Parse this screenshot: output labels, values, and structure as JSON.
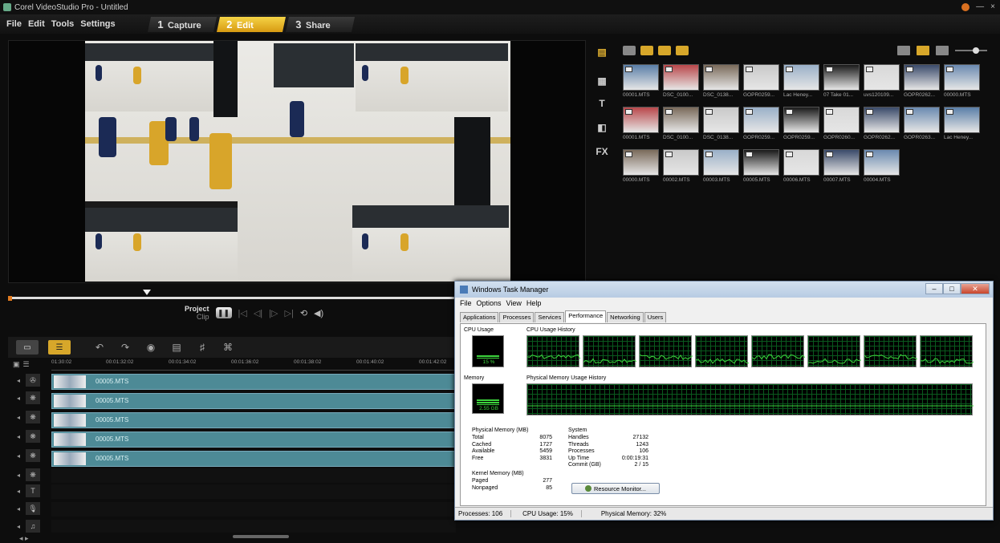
{
  "app": {
    "title": "Corel VideoStudio Pro - Untitled",
    "menu": [
      "File",
      "Edit",
      "Tools",
      "Settings"
    ],
    "steps": [
      {
        "num": "1",
        "label": "Capture",
        "active": false
      },
      {
        "num": "2",
        "label": "Edit",
        "active": true
      },
      {
        "num": "3",
        "label": "Share",
        "active": false
      }
    ],
    "window_controls": {
      "minimize": "—",
      "close": "×"
    }
  },
  "player": {
    "project_label": "Project",
    "clip_label": "Clip"
  },
  "library": {
    "side_tabs": [
      "media-icon",
      "instant-project-icon",
      "title-icon",
      "transition-icon",
      "FX"
    ],
    "thumbnails": [
      [
        "00001.MTS",
        "DSC_0100...",
        "DSC_0138...",
        "GOPR0259...",
        "Lac Heney...",
        "07 Take 01...",
        "uvs120109...",
        "GOPR0262...",
        "00000.MTS"
      ],
      [
        "00001.MTS",
        "DSC_0100...",
        "DSC_0138...",
        "GOPR0259...",
        "GOPR0259...",
        "GOPR0260...",
        "GOPR0262...",
        "GOPR0263...",
        "Lac Heney..."
      ],
      [
        "00000.MTS",
        "00002.MTS",
        "00003.MTS",
        "00005.MTS",
        "00006.MTS",
        "00007.MTS",
        "00004.MTS"
      ]
    ]
  },
  "timeline": {
    "ruler": [
      "01:30:02",
      "00:01:32:02",
      "00:01:34:02",
      "00:01:36:02",
      "00:01:38:02",
      "00:01:40:02",
      "00:01:42:02"
    ],
    "clips": [
      "00005.MTS",
      "00005.MTS",
      "00005.MTS",
      "00005.MTS",
      "00005.MTS"
    ],
    "track_icons": [
      "video-track",
      "overlay-track",
      "overlay-track",
      "overlay-track",
      "overlay-track",
      "overlay-track",
      "title-track",
      "voice-track",
      "music-track"
    ]
  },
  "task_manager": {
    "title": "Windows Task Manager",
    "menu": [
      "File",
      "Options",
      "View",
      "Help"
    ],
    "tabs": [
      "Applications",
      "Processes",
      "Services",
      "Performance",
      "Networking",
      "Users"
    ],
    "active_tab": "Performance",
    "cpu_usage_label": "CPU Usage",
    "cpu_usage_value": "15 %",
    "cpu_usage_pct": 15,
    "cpu_history_label": "CPU Usage History",
    "memory_label": "Memory",
    "memory_value": "2.55 GB",
    "memory_pct": 32,
    "memory_history_label": "Physical Memory Usage History",
    "physical_memory": {
      "header": "Physical Memory (MB)",
      "rows": [
        [
          "Total",
          "8075"
        ],
        [
          "Cached",
          "1727"
        ],
        [
          "Available",
          "5459"
        ],
        [
          "Free",
          "3831"
        ]
      ]
    },
    "kernel_memory": {
      "header": "Kernel Memory (MB)",
      "rows": [
        [
          "Paged",
          "277"
        ],
        [
          "Nonpaged",
          "85"
        ]
      ]
    },
    "system": {
      "header": "System",
      "rows": [
        [
          "Handles",
          "27132"
        ],
        [
          "Threads",
          "1243"
        ],
        [
          "Processes",
          "106"
        ],
        [
          "Up Time",
          "0:00:19:31"
        ],
        [
          "Commit (GB)",
          "2 / 15"
        ]
      ]
    },
    "resource_monitor_button": "Resource Monitor...",
    "status": {
      "processes": "Processes: 106",
      "cpu": "CPU Usage: 15%",
      "memory": "Physical Memory: 32%"
    }
  }
}
